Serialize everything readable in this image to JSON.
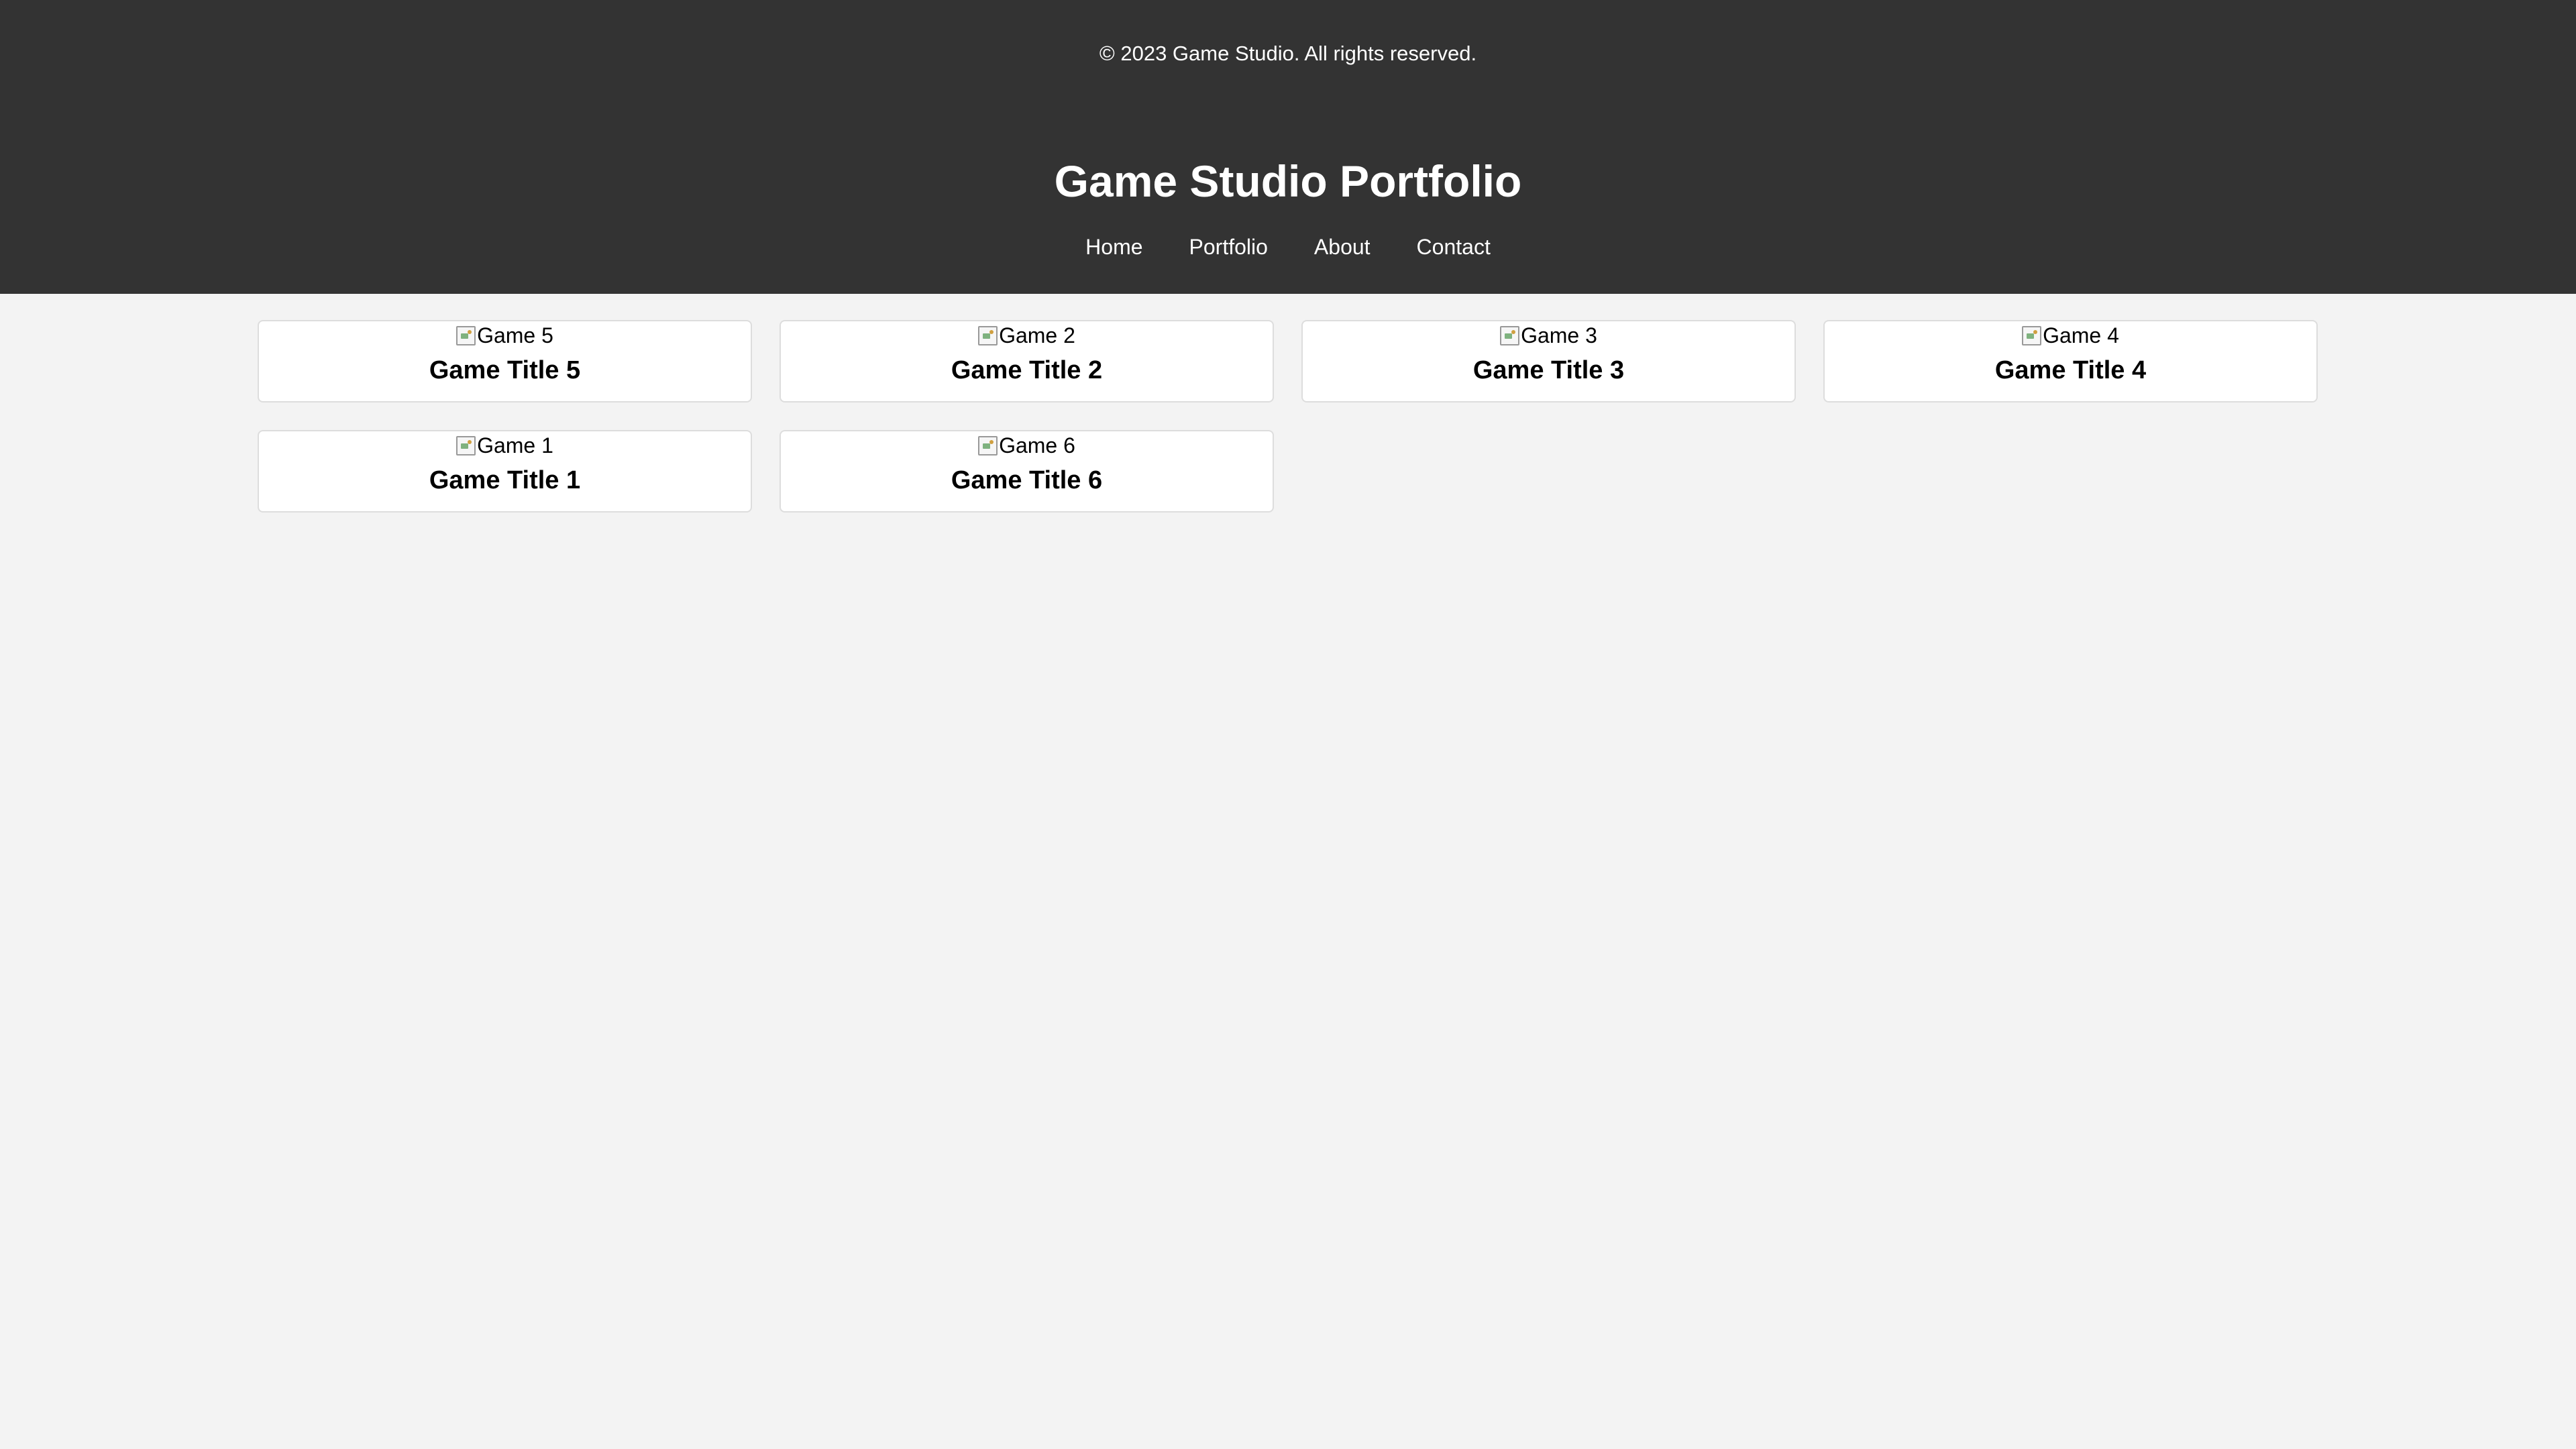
{
  "footer": {
    "copyright": "© 2023 Game Studio. All rights reserved."
  },
  "header": {
    "title": "Game Studio Portfolio",
    "nav": [
      {
        "label": "Home"
      },
      {
        "label": "Portfolio"
      },
      {
        "label": "About"
      },
      {
        "label": "Contact"
      }
    ]
  },
  "games": [
    {
      "image_alt": "Game 5",
      "title": "Game Title 5"
    },
    {
      "image_alt": "Game 2",
      "title": "Game Title 2"
    },
    {
      "image_alt": "Game 3",
      "title": "Game Title 3"
    },
    {
      "image_alt": "Game 4",
      "title": "Game Title 4"
    },
    {
      "image_alt": "Game 1",
      "title": "Game Title 1"
    },
    {
      "image_alt": "Game 6",
      "title": "Game Title 6"
    }
  ],
  "icons": {
    "broken_image": "broken-image-icon"
  },
  "colors": {
    "header_background": "#333333",
    "page_background": "#f3f3f3",
    "card_background": "#ffffff",
    "card_border": "#dddddd"
  }
}
